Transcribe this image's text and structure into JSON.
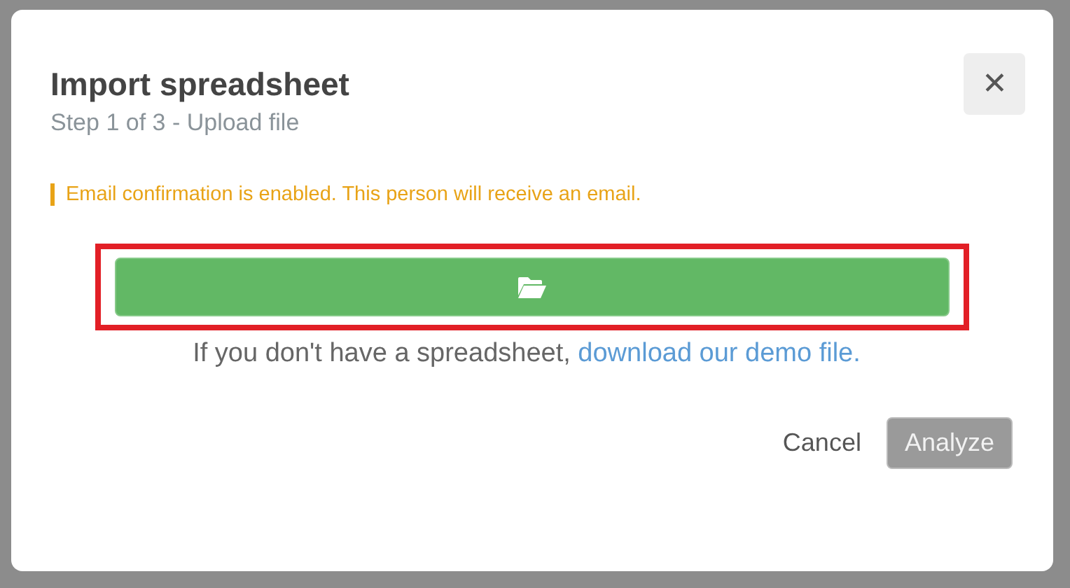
{
  "dialog": {
    "title": "Import spreadsheet",
    "subtitle": "Step 1 of 3 - Upload file",
    "close_label": "✕"
  },
  "notice": {
    "text": "Email confirmation is enabled. This person will receive an email."
  },
  "upload_button": {
    "highlighted": true
  },
  "demo_hint": {
    "text": "If you don't have a spreadsheet,",
    "link": "download our demo file."
  },
  "buttons": [
    {
      "label": "Cancel",
      "kind": "link",
      "disabled": false
    },
    {
      "label": "Analyze",
      "kind": "primary",
      "disabled": true
    }
  ]
}
